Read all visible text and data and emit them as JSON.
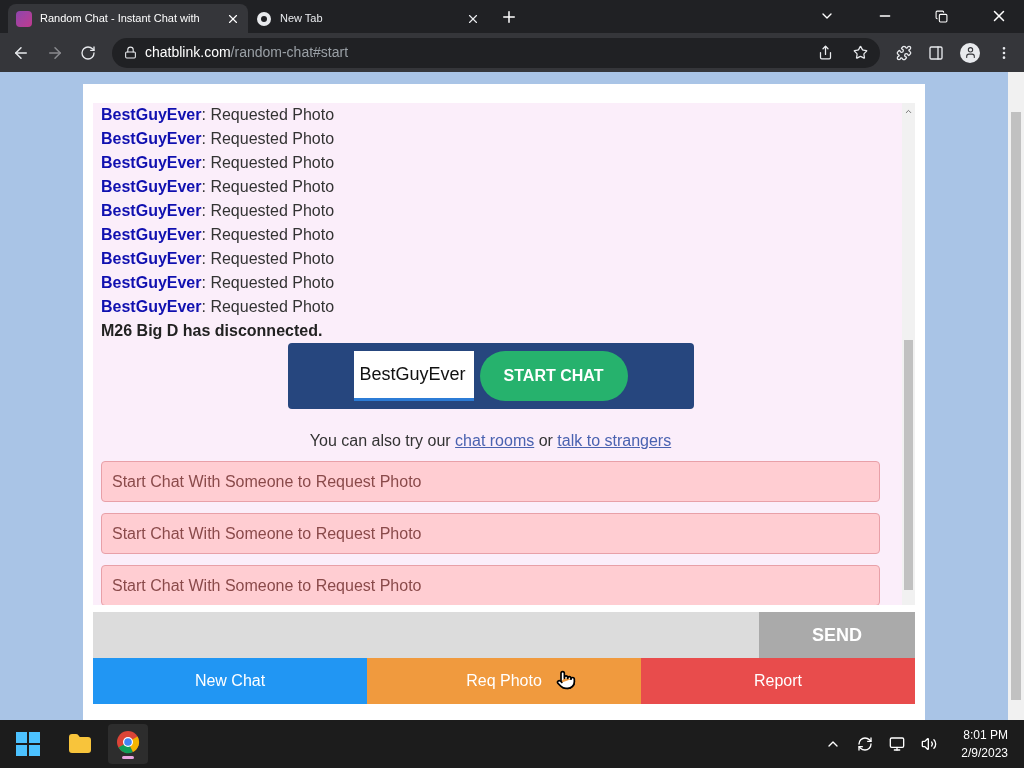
{
  "browser": {
    "tabs": [
      {
        "title": "Random Chat - Instant Chat with",
        "selected": true,
        "kind": "site"
      },
      {
        "title": "New Tab",
        "selected": false,
        "kind": "newtab"
      }
    ],
    "address": {
      "domain": "chatblink.com",
      "path": "/random-chat#start"
    }
  },
  "chat": {
    "messages": [
      {
        "kind": "request",
        "user": "BestGuyEver",
        "text": ": Requested Photo"
      },
      {
        "kind": "request",
        "user": "BestGuyEver",
        "text": ": Requested Photo"
      },
      {
        "kind": "request",
        "user": "BestGuyEver",
        "text": ": Requested Photo"
      },
      {
        "kind": "request",
        "user": "BestGuyEver",
        "text": ": Requested Photo"
      },
      {
        "kind": "request",
        "user": "BestGuyEver",
        "text": ": Requested Photo"
      },
      {
        "kind": "request",
        "user": "BestGuyEver",
        "text": ": Requested Photo"
      },
      {
        "kind": "request",
        "user": "BestGuyEver",
        "text": ": Requested Photo"
      },
      {
        "kind": "request",
        "user": "BestGuyEver",
        "text": ": Requested Photo"
      },
      {
        "kind": "request",
        "user": "BestGuyEver",
        "text": ": Requested Photo"
      },
      {
        "kind": "system",
        "text": "M26 Big D has disconnected."
      }
    ],
    "start_panel": {
      "name_value": "BestGuyEver",
      "button": "START CHAT"
    },
    "also_try": [
      {
        "kind": "text",
        "text": "You can also try our "
      },
      {
        "kind": "link",
        "text": "chat rooms"
      },
      {
        "kind": "text",
        "text": " or "
      },
      {
        "kind": "link",
        "text": "talk to strangers"
      }
    ],
    "photo_requests": [
      "Start Chat With Someone to Request Photo",
      "Start Chat With Someone to Request Photo",
      "Start Chat With Someone to Request Photo"
    ]
  },
  "composer": {
    "send_button": "SEND"
  },
  "actions": [
    {
      "label": "New Chat",
      "color": "#2196f3"
    },
    {
      "label": "Req Photo",
      "color": "#f09a3e"
    },
    {
      "label": "Report",
      "color": "#e84c4c"
    }
  ],
  "taskbar": {
    "time": "8:01 PM",
    "date": "2/9/2023"
  }
}
